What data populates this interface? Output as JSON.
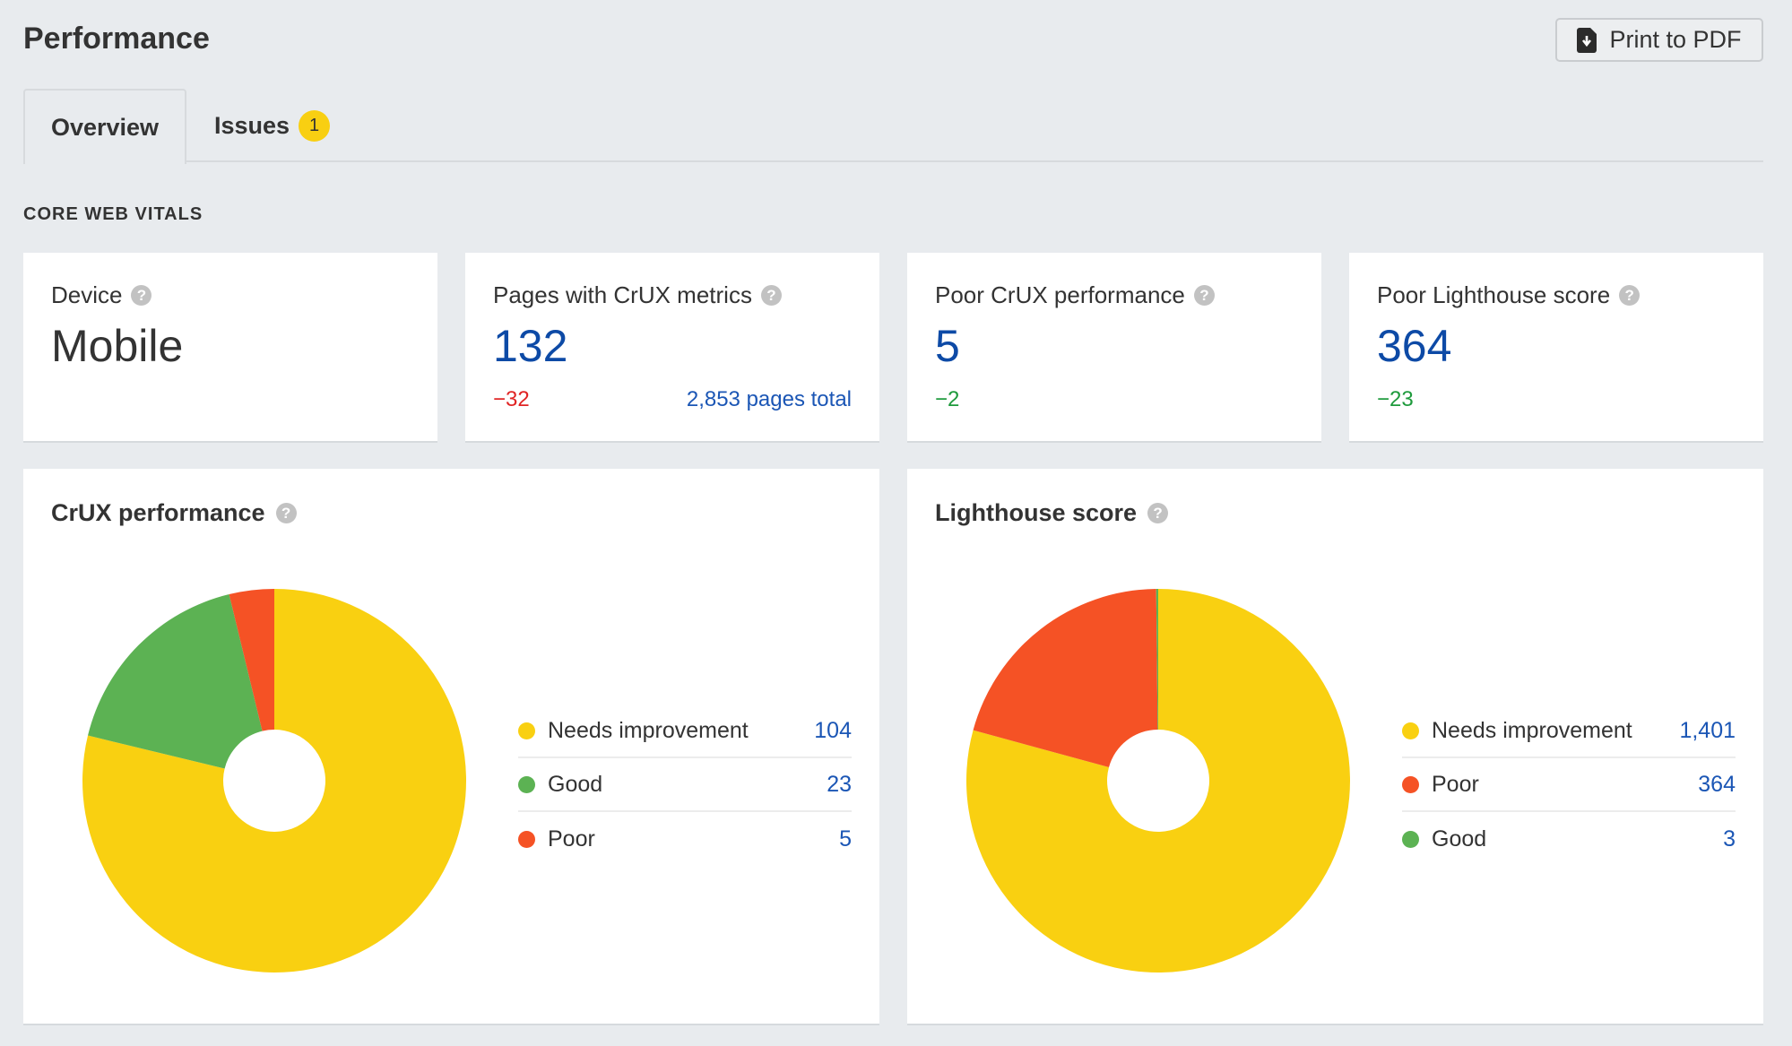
{
  "header": {
    "title": "Performance",
    "print_button": "Print to PDF"
  },
  "tabs": [
    {
      "label": "Overview",
      "active": true
    },
    {
      "label": "Issues",
      "badge": "1"
    }
  ],
  "section_label": "CORE WEB VITALS",
  "help_glyph": "?",
  "stats": [
    {
      "label": "Device",
      "value": "Mobile"
    },
    {
      "label": "Pages with CrUX metrics",
      "value": "132",
      "delta": "−32",
      "extra": "2,853 pages total"
    },
    {
      "label": "Poor CrUX performance",
      "value": "5",
      "delta": "−2"
    },
    {
      "label": "Poor Lighthouse score",
      "value": "364",
      "delta": "−23"
    }
  ],
  "colors": {
    "needs_improvement": "#f9d011",
    "good": "#5cb253",
    "poor": "#f55225",
    "value_blue": "#0d4aa6"
  },
  "chart_data": [
    {
      "type": "pie",
      "title": "CrUX performance",
      "donut": true,
      "legend_position": "right",
      "slices": [
        {
          "label": "Needs improvement",
          "value": 104,
          "display": "104",
          "color": "#f9d011"
        },
        {
          "label": "Good",
          "value": 23,
          "display": "23",
          "color": "#5cb253"
        },
        {
          "label": "Poor",
          "value": 5,
          "display": "5",
          "color": "#f55225"
        }
      ]
    },
    {
      "type": "pie",
      "title": "Lighthouse score",
      "donut": true,
      "legend_position": "right",
      "slices": [
        {
          "label": "Needs improvement",
          "value": 1401,
          "display": "1,401",
          "color": "#f9d011"
        },
        {
          "label": "Poor",
          "value": 364,
          "display": "364",
          "color": "#f55225"
        },
        {
          "label": "Good",
          "value": 3,
          "display": "3",
          "color": "#5cb253"
        }
      ]
    }
  ]
}
